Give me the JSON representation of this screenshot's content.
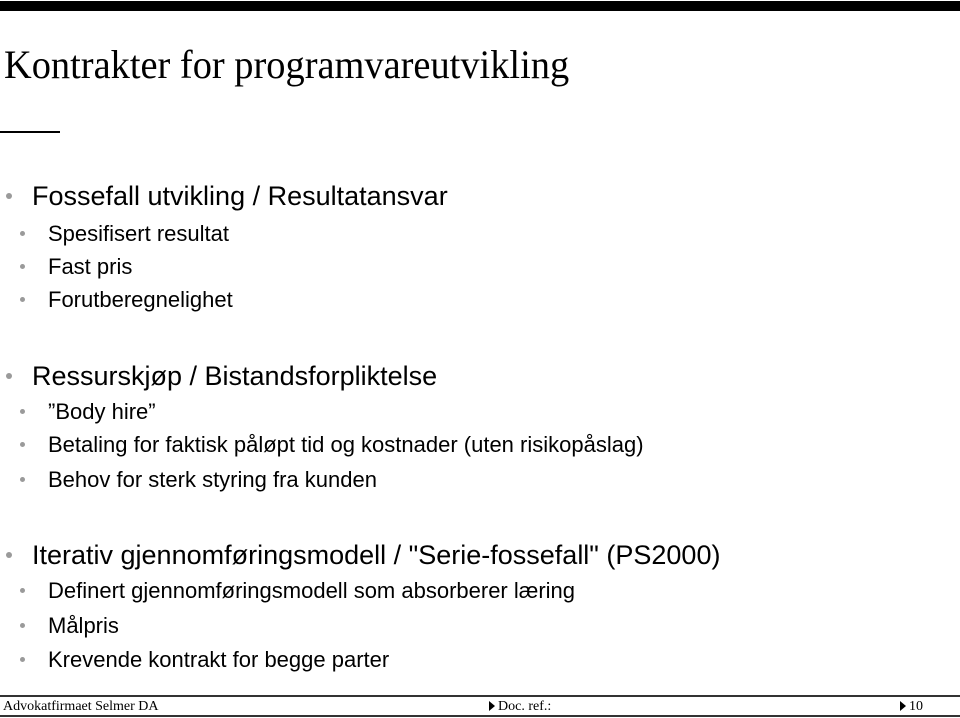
{
  "slide": {
    "title": "Kontrakter for programvareutvikling",
    "sections": [
      {
        "heading": "Fossefall utvikling / Resultatansvar",
        "items": [
          "Spesifisert resultat",
          "Fast pris",
          "Forutberegnelighet"
        ]
      },
      {
        "heading": "Ressurskjøp / Bistandsforpliktelse",
        "items": [
          "”Body hire”",
          "Betaling for faktisk påløpt tid og kostnader (uten risikopåslag)",
          "Behov for sterk styring fra kunden"
        ]
      },
      {
        "heading": "Iterativ gjennomføringsmodell / \"Serie-fossefall\" (PS2000)",
        "items": [
          "Definert gjennomføringsmodell som absorberer læring",
          "Målpris",
          "Krevende kontrakt for begge parter"
        ]
      }
    ]
  },
  "footer": {
    "company": "Advokatfirmaet Selmer DA",
    "doc_ref_label": "Doc. ref.:",
    "page_number": "10"
  }
}
